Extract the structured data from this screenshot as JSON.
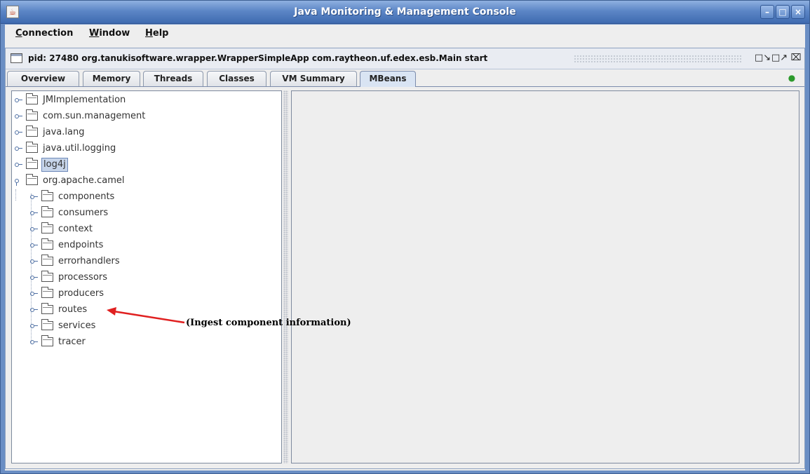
{
  "window": {
    "title": "Java Monitoring & Management Console",
    "icon": "java-icon",
    "buttons": [
      "minimize",
      "maximize",
      "close"
    ]
  },
  "menu": [
    {
      "mnemonic": "C",
      "rest": "onnection"
    },
    {
      "mnemonic": "W",
      "rest": "indow"
    },
    {
      "mnemonic": "H",
      "rest": "elp"
    }
  ],
  "connection_frame": {
    "title": "pid: 27480 org.tanukisoftware.wrapper.WrapperSimpleApp com.raytheon.uf.edex.esb.Main start",
    "icon": "frame-icon"
  },
  "tabs": [
    "Overview",
    "Memory",
    "Threads",
    "Classes",
    "VM Summary",
    "MBeans"
  ],
  "active_tab": "MBeans",
  "tree": {
    "root_items": [
      "JMImplementation",
      "com.sun.management",
      "java.lang",
      "java.util.logging",
      "log4j",
      "org.apache.camel"
    ],
    "selected": "log4j",
    "expanded": "org.apache.camel",
    "children": [
      "components",
      "consumers",
      "context",
      "endpoints",
      "errorhandlers",
      "processors",
      "producers",
      "routes",
      "services",
      "tracer"
    ]
  },
  "annotation": {
    "text": "(Ingest component information)",
    "target": "routes",
    "arrow_color": "#e02020"
  },
  "colors": {
    "titlebar": "#5c86c6",
    "selection": "#c7d5ea",
    "connection_indicator": "#2c9a2c"
  }
}
